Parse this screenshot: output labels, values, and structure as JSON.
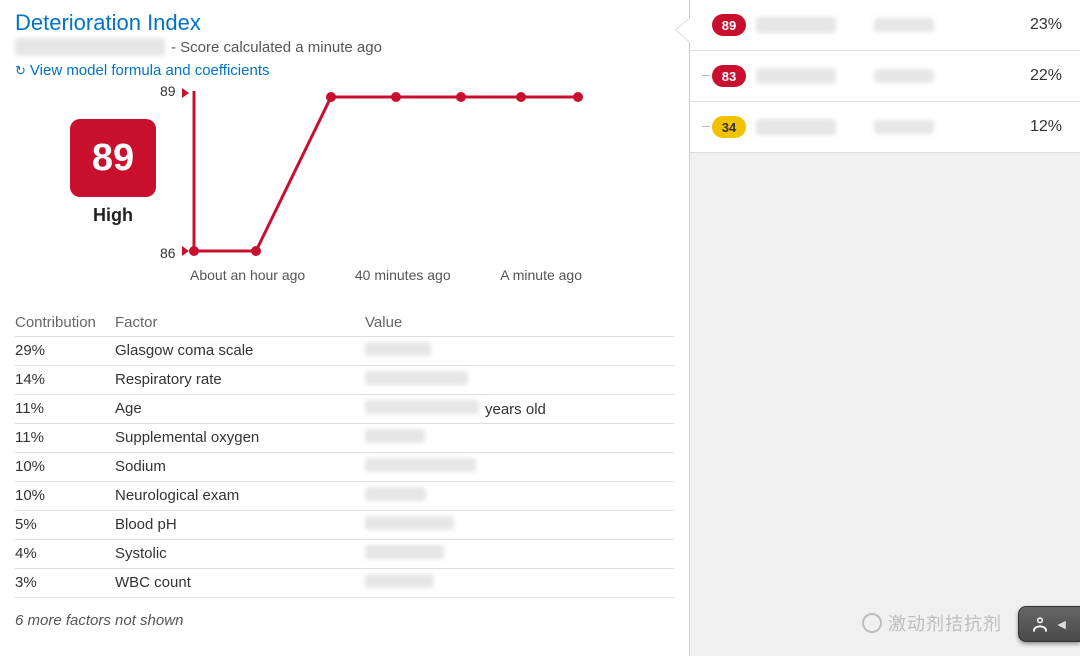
{
  "header": {
    "title": "Deterioration Index",
    "subtitle_suffix": "- Score calculated a minute ago",
    "link_label": "View model formula and coefficients"
  },
  "score": {
    "value": "89",
    "level": "High"
  },
  "chart_data": {
    "type": "line",
    "title": "",
    "xlabel": "",
    "ylabel": "",
    "ylim": [
      86,
      89
    ],
    "y_ticks": [
      "89",
      "86"
    ],
    "x_categories": [
      "About an hour ago",
      "40 minutes ago",
      "A minute ago"
    ],
    "series": [
      {
        "name": "Deterioration Index",
        "values": [
          86,
          86,
          89,
          89,
          89,
          89,
          89
        ]
      }
    ]
  },
  "factors": {
    "col_contrib": "Contribution",
    "col_factor": "Factor",
    "col_value": "Value",
    "rows": [
      {
        "contribution": "29%",
        "factor": "Glasgow coma scale",
        "value_suffix": ""
      },
      {
        "contribution": "14%",
        "factor": "Respiratory rate",
        "value_suffix": ""
      },
      {
        "contribution": "11%",
        "factor": "Age",
        "value_suffix": "years old"
      },
      {
        "contribution": "11%",
        "factor": "Supplemental oxygen",
        "value_suffix": ""
      },
      {
        "contribution": "10%",
        "factor": "Sodium",
        "value_suffix": ""
      },
      {
        "contribution": "10%",
        "factor": "Neurological exam",
        "value_suffix": ""
      },
      {
        "contribution": "5%",
        "factor": "Blood pH",
        "value_suffix": ""
      },
      {
        "contribution": "4%",
        "factor": "Systolic",
        "value_suffix": ""
      },
      {
        "contribution": "3%",
        "factor": "WBC count",
        "value_suffix": ""
      }
    ],
    "more_note": "6 more factors not shown"
  },
  "patients": [
    {
      "badge": "89",
      "badge_color": "red",
      "percent": "23%",
      "active": true
    },
    {
      "badge": "83",
      "badge_color": "red",
      "percent": "22%",
      "active": false
    },
    {
      "badge": "34",
      "badge_color": "yellow",
      "percent": "12%",
      "active": false
    }
  ],
  "watermark": {
    "text": "激动剂拮抗剂"
  },
  "chat_tab": {
    "icon": "person-icon"
  }
}
